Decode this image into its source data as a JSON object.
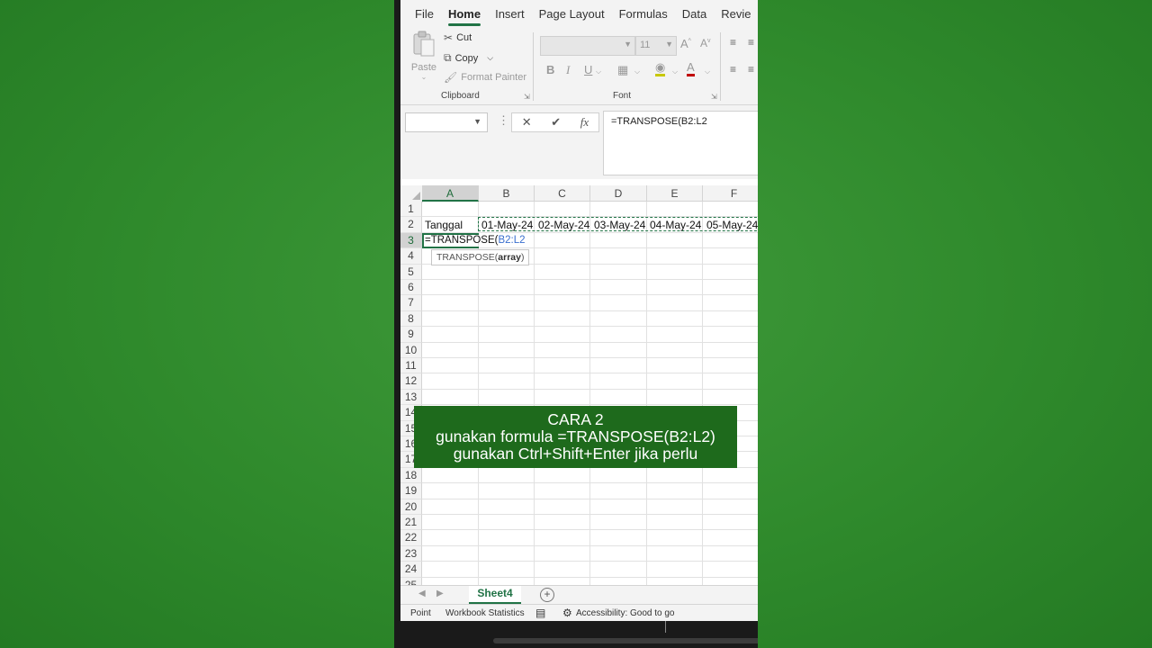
{
  "ribbon": {
    "tabs": [
      "File",
      "Home",
      "Insert",
      "Page Layout",
      "Formulas",
      "Data",
      "Revie"
    ],
    "active_tab": "Home",
    "clipboard": {
      "paste": "Paste",
      "cut": "Cut",
      "copy": "Copy",
      "format_painter": "Format Painter",
      "group_label": "Clipboard"
    },
    "font": {
      "font_size": "11",
      "group_label": "Font",
      "bold": "B",
      "italic": "I",
      "underline": "U"
    }
  },
  "formula_bar": {
    "name_box": "",
    "formula": "=TRANSPOSE(B2:L2"
  },
  "grid": {
    "columns": [
      "A",
      "B",
      "C",
      "D",
      "E",
      "F"
    ],
    "rows": [
      "1",
      "2",
      "3",
      "4",
      "5",
      "6",
      "7",
      "8",
      "9",
      "10",
      "11",
      "12",
      "13",
      "14",
      "15",
      "16",
      "17",
      "18",
      "19",
      "20",
      "21",
      "22",
      "23",
      "24",
      "25"
    ],
    "cells": {
      "A2": "Tanggal",
      "B2": "01-May-24",
      "C2": "02-May-24",
      "D2": "03-May-24",
      "E2": "04-May-24",
      "F2": "05-May-24",
      "A3_formula": "=TRANSPOSE(",
      "A3_ref": "B2:L2"
    },
    "tooltip": {
      "fn": "TRANSPOSE(",
      "arg": "array",
      "close": ")"
    }
  },
  "sheets": {
    "active": "Sheet4"
  },
  "status_bar": {
    "mode": "Point",
    "workbook_stats": "Workbook Statistics",
    "accessibility": "Accessibility: Good to go"
  },
  "caption": {
    "line1": "CARA 2",
    "line2": "gunakan formula =TRANSPOSE(B2:L2)",
    "line3": "gunakan Ctrl+Shift+Enter jika perlu"
  },
  "colors": {
    "excel_green": "#217346",
    "caption_bg": "#1e6a1c",
    "background": "#2f8a2c"
  }
}
